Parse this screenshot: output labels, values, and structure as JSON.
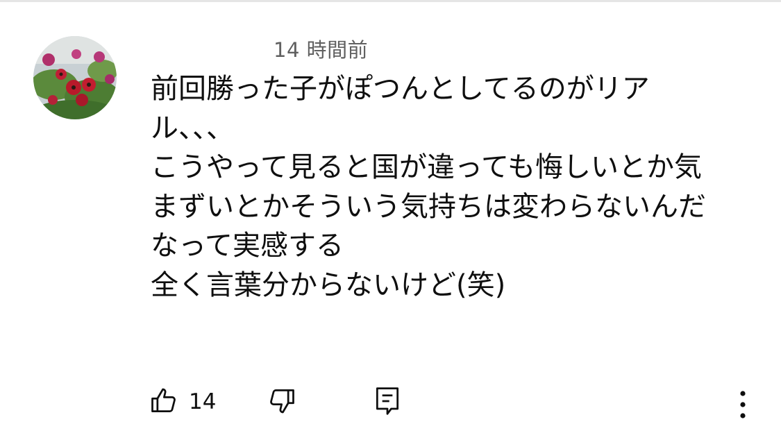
{
  "comment": {
    "timestamp": "14 時間前",
    "lines": [
      "前回勝った子がぽつんとしてるのがリア",
      "ル、、、",
      "こうやって見ると国が違っても悔しいとか気",
      "まずいとかそういう気持ちは変わらないんだ",
      "なって実感する",
      "全く言葉分からないけど(笑)"
    ],
    "like_count": "14"
  },
  "icons": {
    "avatar": "flower-avatar",
    "like": "thumbs-up-icon",
    "dislike": "thumbs-down-icon",
    "reply": "reply-comment-icon",
    "more": "more-vertical-icon"
  },
  "colors": {
    "text": "#0f0f0f",
    "secondary_text": "#606060",
    "divider": "#e5e5e5"
  }
}
